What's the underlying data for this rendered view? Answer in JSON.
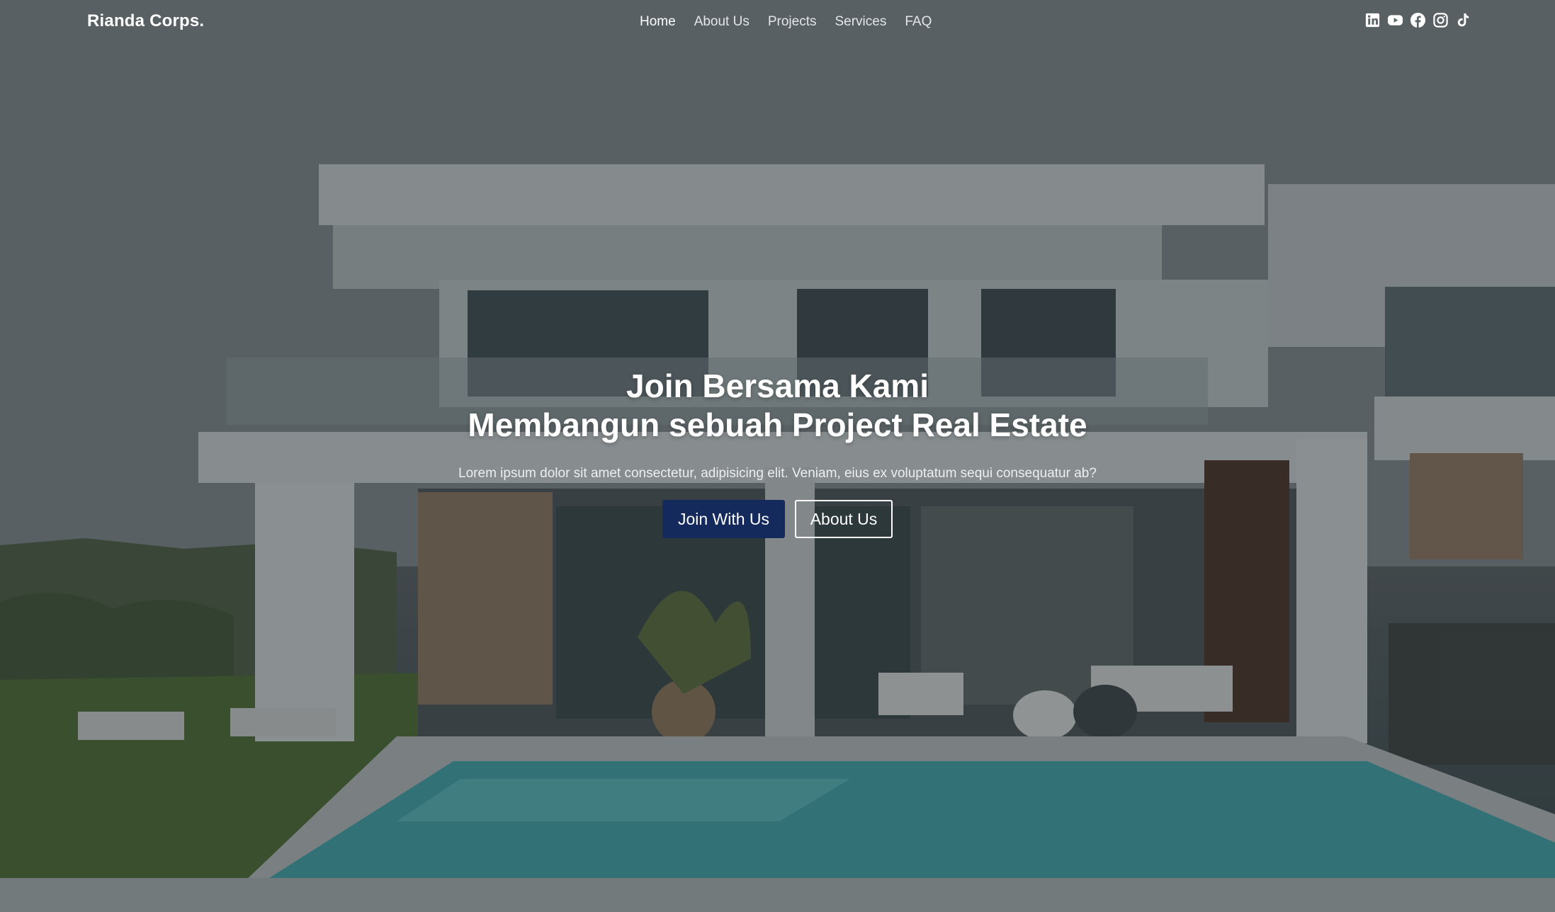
{
  "brand": {
    "name": "Rianda Corps."
  },
  "nav": {
    "items": [
      {
        "label": "Home",
        "active": true
      },
      {
        "label": "About Us",
        "active": false
      },
      {
        "label": "Projects",
        "active": false
      },
      {
        "label": "Services",
        "active": false
      },
      {
        "label": "FAQ",
        "active": false
      }
    ]
  },
  "socials": [
    {
      "icon": "linkedin-icon"
    },
    {
      "icon": "youtube-icon"
    },
    {
      "icon": "facebook-icon"
    },
    {
      "icon": "instagram-icon"
    },
    {
      "icon": "tiktok-icon"
    }
  ],
  "hero": {
    "headline_line1": "Join Bersama Kami",
    "headline_line2": "Membangun sebuah Project Real Estate",
    "subtitle": "Lorem ipsum dolor sit amet consectetur, adipisicing elit. Veniam, eius ex voluptatum sequi consequatur ab?",
    "primary_button": "Join With Us",
    "secondary_button": "About Us",
    "background_image": "modern-villa-with-pool-photo"
  },
  "colors": {
    "primary_button_bg": "#152a5c",
    "text": "#ffffff",
    "overlay": "#1e2226"
  }
}
